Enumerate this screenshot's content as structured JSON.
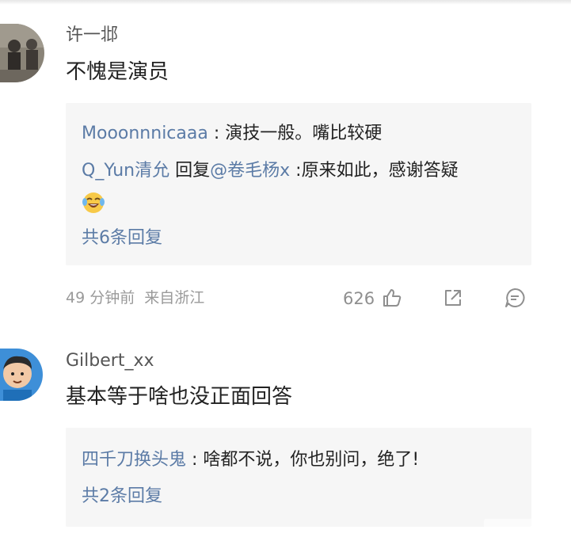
{
  "comments": [
    {
      "username": "许一邶",
      "text": "不愧是演员",
      "replies": [
        {
          "author": "Mooonnnicaaa",
          "separator": " : ",
          "text": "演技一般。嘴比较硬"
        },
        {
          "author": "Q_Yun清允",
          "action": " 回复",
          "target": "@卷毛杨x",
          "separator": " :",
          "text": "原来如此，感谢答疑"
        }
      ],
      "reply_count": "共6条回复",
      "time": "49 分钟前",
      "location": "来自浙江",
      "likes": "626"
    },
    {
      "username": "Gilbert_xx",
      "text": "基本等于啥也没正面回答",
      "replies": [
        {
          "author": "四千刀换头鬼",
          "separator": " : ",
          "text": "啥都不说，你也别问，绝了!"
        }
      ],
      "reply_count": "共2条回复"
    }
  ],
  "icons": {
    "like": "thumbs-up-icon",
    "share": "share-icon",
    "comment": "comment-icon",
    "emoji": "laughing-tears-emoji-icon"
  },
  "colors": {
    "link": "#5b7ba6",
    "reply_bg": "#f6f6f6",
    "meta": "#9a9a9a"
  }
}
